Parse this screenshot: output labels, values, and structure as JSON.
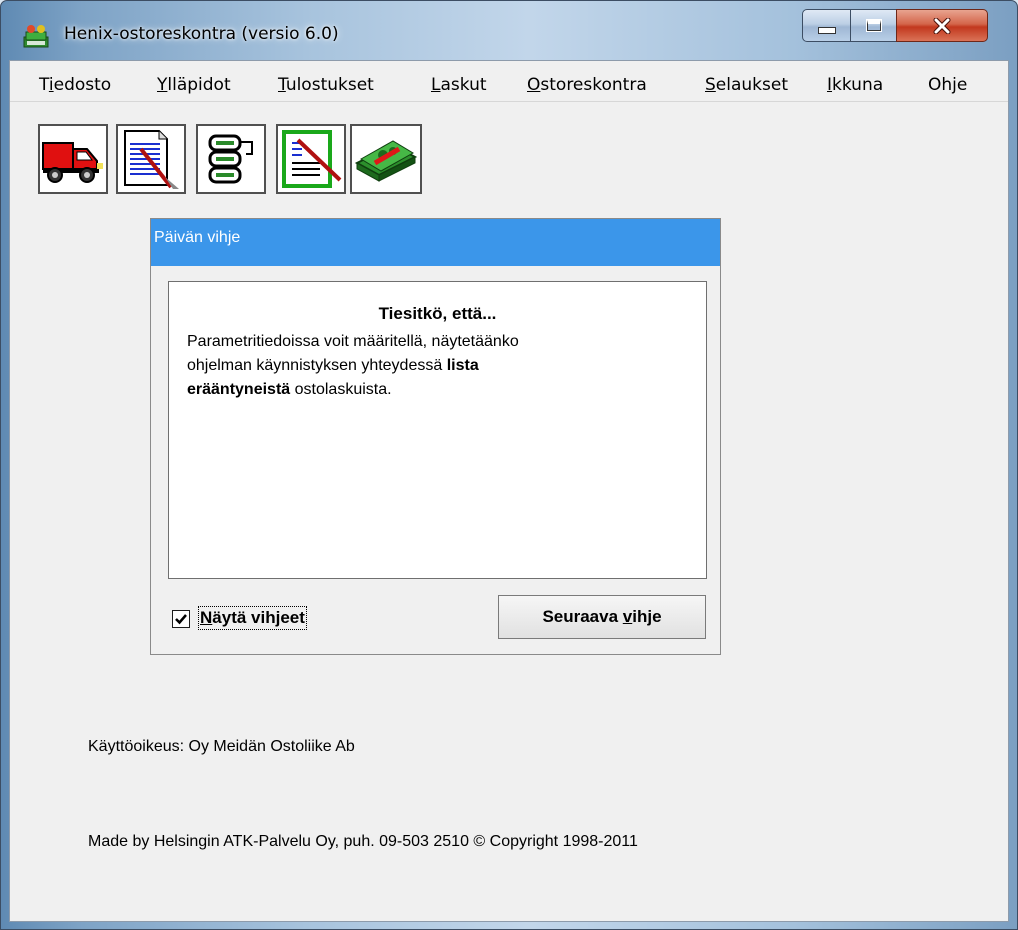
{
  "window": {
    "title": "Henix-ostoreskontra (versio 6.0)",
    "controls": [
      "minimize-icon",
      "maximize-icon",
      "close-icon"
    ]
  },
  "menu": [
    {
      "ul": "",
      "first": "T",
      "ulchar": "i",
      "rest": "edosto"
    },
    {
      "ul": "Y",
      "rest": "lläpidot"
    },
    {
      "ul": "T",
      "rest": "ulostukset"
    },
    {
      "ul": "L",
      "rest": "askut"
    },
    {
      "ul": "O",
      "rest": "storeskontra"
    },
    {
      "ul": "S",
      "rest": "elaukset"
    },
    {
      "ul": "I",
      "rest": "kkuna"
    },
    {
      "ul": "",
      "rest": "Ohje"
    }
  ],
  "toolbar": [
    "truck-icon",
    "document-edit-icon",
    "database-icon",
    "list-edit-icon",
    "money-icon"
  ],
  "dialog": {
    "title": "Päivän vihje",
    "heading": "Tiesitkö, että...",
    "line1": "Parametritiedoissa voit määritellä, näytetäänko",
    "line2_plain": "ohjelman käynnistyksen yhteydessä ",
    "line2_bold": "lista",
    "line3_bold": "erääntyneistä",
    "line3_plain": " ostolaskuista.",
    "checkbox_checked": true,
    "checkbox_ul": "N",
    "checkbox_rest": "äytä vihjeet",
    "next_pre": "Seuraava ",
    "next_ul": "v",
    "next_rest": "ihje"
  },
  "footer": {
    "license": "Käyttöoikeus: Oy Meidän Ostoliike Ab",
    "credits": "Made by Helsingin ATK-Palvelu Oy, puh. 09-503 2510 © Copyright 1998-2011"
  },
  "colors": {
    "dialog_title": "#3b96ea",
    "close_button": "#c2381e"
  }
}
